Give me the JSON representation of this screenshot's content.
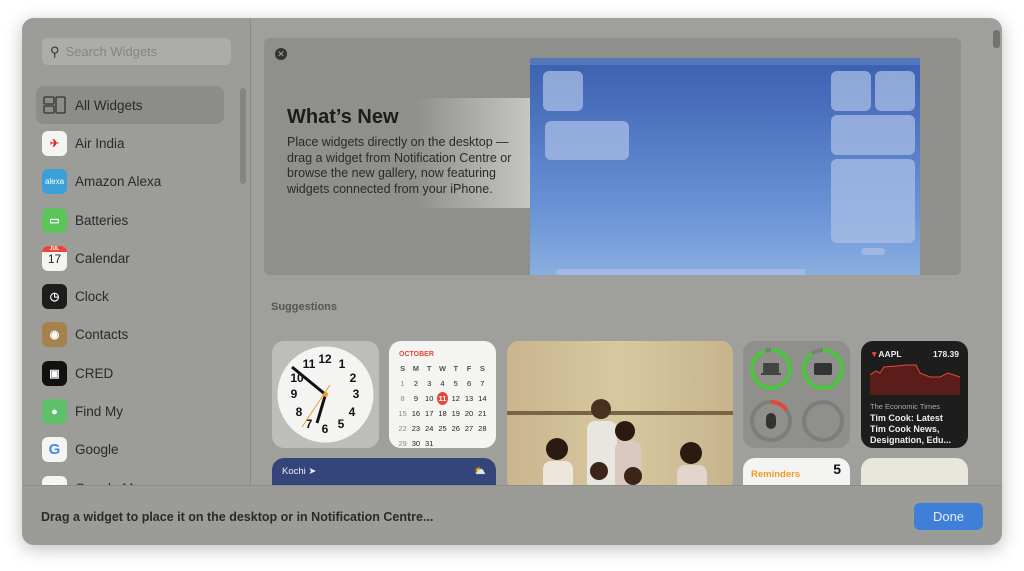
{
  "search": {
    "placeholder": "Search Widgets"
  },
  "sidebar": {
    "items": [
      {
        "label": "All Widgets",
        "icon": "widgets-grid-icon",
        "selected": true
      },
      {
        "label": "Air India",
        "icon": "air-india-icon"
      },
      {
        "label": "Amazon Alexa",
        "icon": "alexa-icon",
        "icon_text": "alexa"
      },
      {
        "label": "Batteries",
        "icon": "battery-icon"
      },
      {
        "label": "Calendar",
        "icon": "calendar-icon",
        "icon_month": "JUL",
        "icon_day": "17"
      },
      {
        "label": "Clock",
        "icon": "clock-icon"
      },
      {
        "label": "Contacts",
        "icon": "contacts-icon"
      },
      {
        "label": "CRED",
        "icon": "cred-icon"
      },
      {
        "label": "Find My",
        "icon": "find-my-icon"
      },
      {
        "label": "Google",
        "icon": "google-icon",
        "icon_text": "G"
      },
      {
        "label": "Google Maps",
        "icon": "google-maps-icon"
      }
    ]
  },
  "hero": {
    "title": "What’s New",
    "body": "Place widgets directly on the desktop — drag a widget from Notification Centre or browse the new gallery, now featuring widgets connected from your iPhone."
  },
  "suggestions_label": "Suggestions",
  "calendar": {
    "month": "OCTOBER",
    "days": [
      "S",
      "M",
      "T",
      "W",
      "T",
      "F",
      "S"
    ],
    "weeks": [
      [
        "1",
        "2",
        "3",
        "4",
        "5",
        "6",
        "7"
      ],
      [
        "8",
        "9",
        "10",
        "11",
        "12",
        "13",
        "14"
      ],
      [
        "15",
        "16",
        "17",
        "18",
        "19",
        "20",
        "21"
      ],
      [
        "22",
        "23",
        "24",
        "25",
        "26",
        "27",
        "28"
      ],
      [
        "29",
        "30",
        "31",
        "",
        "",
        "",
        ""
      ]
    ],
    "today": "11",
    "accent": "#e8453c"
  },
  "stocks": {
    "symbol": "AAPL",
    "price": "178.39",
    "source": "The Economic Times",
    "headline": "Tim Cook: Latest Tim Cook News, Designation, Edu..."
  },
  "weather": {
    "city": "Kochi"
  },
  "reminders": {
    "title": "Reminders",
    "count": "5"
  },
  "batteries": {
    "levels": [
      0.95,
      0.9,
      0.15,
      0
    ]
  },
  "footer": {
    "message": "Drag a widget to place it on the desktop or in Notification Centre...",
    "done": "Done"
  },
  "colors": {
    "accent": "#3f7fd7",
    "battery_green": "#4cc63e",
    "battery_low": "#e8453c",
    "reminders": "#f09a2a"
  }
}
